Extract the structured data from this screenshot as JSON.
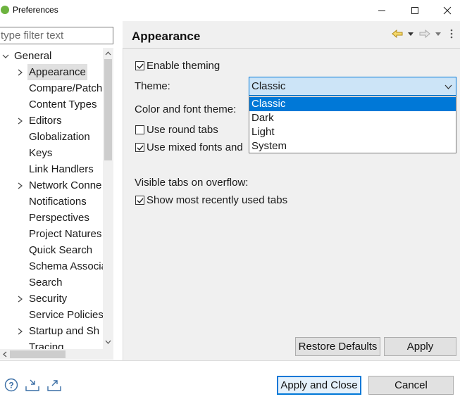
{
  "window": {
    "title": "Preferences",
    "minimize_icon": "minimize-icon",
    "maximize_icon": "maximize-icon",
    "close_icon": "close-icon"
  },
  "filter": {
    "placeholder": "type filter text"
  },
  "tree": {
    "root": "General",
    "items": [
      {
        "label": "Appearance",
        "expandable": true,
        "selected": true
      },
      {
        "label": "Compare/Patch",
        "expandable": false
      },
      {
        "label": "Content Types",
        "expandable": false
      },
      {
        "label": "Editors",
        "expandable": true
      },
      {
        "label": "Globalization",
        "expandable": false
      },
      {
        "label": "Keys",
        "expandable": false
      },
      {
        "label": "Link Handlers",
        "expandable": false
      },
      {
        "label": "Network Conne",
        "expandable": true
      },
      {
        "label": "Notifications",
        "expandable": false
      },
      {
        "label": "Perspectives",
        "expandable": false
      },
      {
        "label": "Project Natures",
        "expandable": false
      },
      {
        "label": "Quick Search",
        "expandable": false
      },
      {
        "label": "Schema Associa",
        "expandable": false
      },
      {
        "label": "Search",
        "expandable": false
      },
      {
        "label": "Security",
        "expandable": true
      },
      {
        "label": "Service Policies",
        "expandable": false
      },
      {
        "label": "Startup and Sh",
        "expandable": true
      },
      {
        "label": "Tracing",
        "expandable": false
      }
    ]
  },
  "page": {
    "title": "Appearance",
    "enable_theming": {
      "label": "Enable theming",
      "checked": true
    },
    "theme_label": "Theme:",
    "theme_value": "Classic",
    "theme_options": [
      "Classic",
      "Dark",
      "Light",
      "System"
    ],
    "color_font_theme_label": "Color and font theme:",
    "use_round_tabs": {
      "label": "Use round tabs",
      "checked": false
    },
    "use_mixed_fonts": {
      "label": "Use mixed fonts and",
      "checked": true
    },
    "visible_tabs_label": "Visible tabs on overflow:",
    "show_recent_tabs": {
      "label": "Show most recently used tabs",
      "checked": true
    }
  },
  "buttons": {
    "restore_defaults": "Restore Defaults",
    "apply": "Apply",
    "apply_and_close": "Apply and Close",
    "cancel": "Cancel"
  },
  "colors": {
    "accent": "#0078d7",
    "combo_bg": "#cce4f7",
    "panel_bg": "#f0f0f0",
    "app_icon": "#6db33f"
  }
}
